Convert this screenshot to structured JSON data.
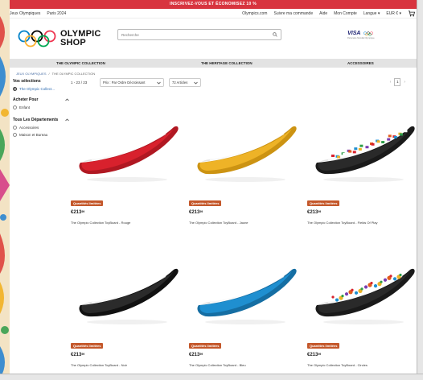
{
  "promo": {
    "text": "INSCRIVEZ-VOUS ET ÉCONOMISEZ 10 %"
  },
  "utility": {
    "left": [
      "Jeux Olympiques",
      "Paris 2024"
    ],
    "right": [
      "Olympics.com",
      "Suivre ma commande",
      "Aide",
      "Mon Compte",
      "Langue ▾",
      "EUR € ▾"
    ]
  },
  "header": {
    "logo_line1": "OLYMPIC",
    "logo_line2": "SHOP",
    "search_placeholder": "Recherche",
    "partner_brand": "VISA",
    "partner_sub": "Partenaire Mondial Olympique"
  },
  "nav": {
    "items": [
      "THE OLYMPIC COLLECTION",
      "THE HERITAGE COLLECTION",
      "ACCESSOIRES"
    ]
  },
  "breadcrumb": {
    "home": "JEUX OLYMPIQUES",
    "sep": "/",
    "current": "THE OLYMPIC COLLECTION"
  },
  "sidebar": {
    "selections_title": "Vos sélections",
    "selection_value": "The Olympic Collect...",
    "buy_for_title": "Acheter Pour",
    "buy_for_item": "Enfant",
    "departments_title": "Tous Les Départements",
    "departments": [
      "Accessoires",
      "Maison et Bureau"
    ]
  },
  "toolbar": {
    "count": "1 - 23 / 23",
    "sort": "Prix : Par Ordre Décroissant",
    "per_page": "72 Articles",
    "page": "1",
    "prev": "‹",
    "next": "›"
  },
  "products": [
    {
      "badge": "Quantités limitées",
      "price": "213",
      "price_cents": "99",
      "name": "The Olympic Collection ToyBoard - Rouge",
      "color": "#d8212d",
      "rim": "#b01822",
      "pattern": "solid"
    },
    {
      "badge": "Quantités limitées",
      "price": "213",
      "price_cents": "99",
      "name": "The Olympic Collection ToyBoard - Jaune",
      "color": "#eeb327",
      "rim": "#cc9312",
      "pattern": "solid"
    },
    {
      "badge": "Quantités limitées",
      "price": "213",
      "price_cents": "99",
      "name": "The Olympic Collection ToyBoard - Fields Of Play",
      "color": "#2a2a2a",
      "rim": "#1a1a1a",
      "pattern": "flags"
    },
    {
      "badge": "Quantités limitées",
      "price": "213",
      "price_cents": "99",
      "name": "The Olympic Collection ToyBoard - Noir",
      "color": "#2b2b2b",
      "rim": "#111111",
      "pattern": "solid"
    },
    {
      "badge": "Quantités limitées",
      "price": "213",
      "price_cents": "99",
      "name": "The Olympic Collection ToyBoard - Bleu",
      "color": "#1f8fd0",
      "rim": "#156ea3",
      "pattern": "solid"
    },
    {
      "badge": "Quantités limitées",
      "price": "213",
      "price_cents": "99",
      "name": "The Olympic Collection ToyBoard - Circles",
      "color": "#2a2a2a",
      "rim": "#1a1a1a",
      "pattern": "circles"
    }
  ],
  "colors": {
    "promo": "#d8343f",
    "nav_bg": "#e3e3e3",
    "badge": "#c4582b",
    "ring_blue": "#0081c8",
    "ring_yellow": "#fcb131",
    "ring_black": "#000000",
    "ring_green": "#00a651",
    "ring_red": "#ee334e"
  }
}
